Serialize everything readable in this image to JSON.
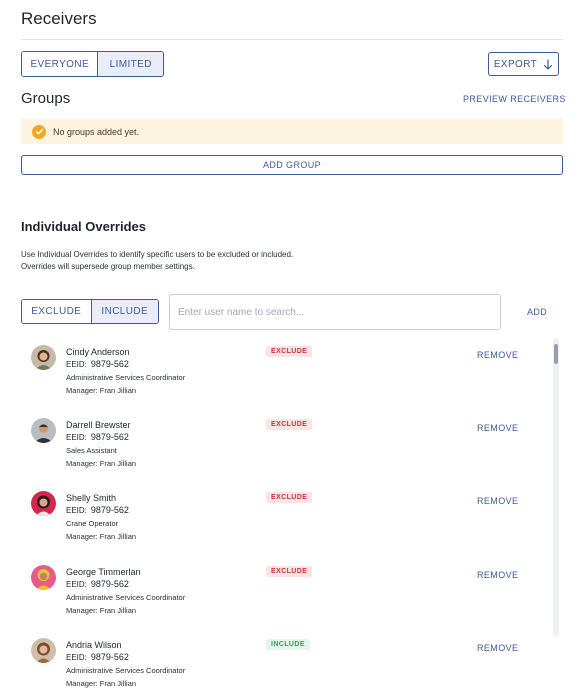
{
  "receivers": {
    "title": "Receivers",
    "audience_options": [
      "EVERYONE",
      "LIMITED"
    ],
    "audience_selected": "LIMITED",
    "export_label": "EXPORT"
  },
  "groups": {
    "title": "Groups",
    "preview_label": "PREVIEW RECEIVERS",
    "alert_text": "No groups added yet.",
    "add_group_label": "ADD GROUP"
  },
  "overrides": {
    "title": "Individual Overrides",
    "description": "Use Individual Overrides to identify specific users to be excluded or included. Overrides will supersede group member settings.",
    "mode_options": [
      "EXCLUDE",
      "INCLUDE"
    ],
    "mode_selected": "INCLUDE",
    "search_value": "",
    "search_placeholder": "Enter user name to search...",
    "add_label": "ADD",
    "eeid_label": "EEID:",
    "remove_label": "REMOVE",
    "users": [
      {
        "name": "Cindy Anderson",
        "eeid": "9879-562",
        "role": "Administrative Services Coordinator",
        "manager": "Manager: Fran Jillian",
        "status": "EXCLUDE"
      },
      {
        "name": "Darrell Brewster",
        "eeid": "9879-562",
        "role": "Sales Assistant",
        "manager": "Manager: Fran Jillian",
        "status": "EXCLUDE"
      },
      {
        "name": "Shelly Smith",
        "eeid": "9879-562",
        "role": "Crane Operator",
        "manager": "Manager: Fran Jillian",
        "status": "EXCLUDE"
      },
      {
        "name": "George Timmerlan",
        "eeid": "9879-562",
        "role": "Administrative Services Coordinator",
        "manager": "Manager: Fran Jillian",
        "status": "EXCLUDE"
      },
      {
        "name": "Andria Wilson",
        "eeid": "9879-562",
        "role": "Administrative Services Coordinator",
        "manager": "Manager: Fran Jillian",
        "status": "INCLUDE"
      }
    ]
  },
  "colors": {
    "accent": "#3f5a99",
    "exclude_badge_bg": "#fde3e3",
    "exclude_badge_text": "#c8353a",
    "include_badge_bg": "#e2f6e9",
    "include_badge_text": "#3a9a5c",
    "alert_bg": "#fdf3e1",
    "alert_icon": "#f2a825"
  },
  "icons": {
    "export": "arrow-down-icon",
    "alert": "check-circle-icon"
  }
}
